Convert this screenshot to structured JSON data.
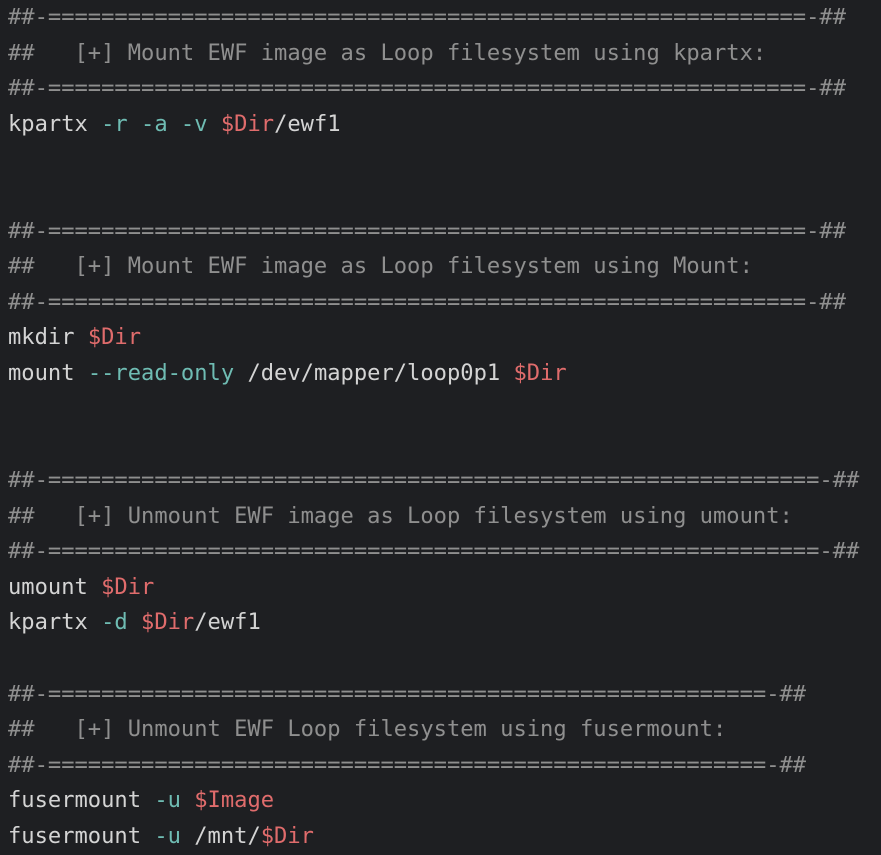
{
  "colors": {
    "background": "#1e1f22",
    "comment": "#8f8f8f",
    "text": "#d4d4d4",
    "flag": "#6fbcb3",
    "variable": "#e06c6c"
  },
  "lines": [
    [
      {
        "t": "comment",
        "v": "##-=========================================================-##"
      }
    ],
    [
      {
        "t": "comment",
        "v": "##   [+] Mount EWF image as Loop filesystem using kpartx:"
      }
    ],
    [
      {
        "t": "comment",
        "v": "##-=========================================================-##"
      }
    ],
    [
      {
        "t": "plain",
        "v": "kpartx "
      },
      {
        "t": "flag",
        "v": "-r -a -v "
      },
      {
        "t": "var",
        "v": "$Dir"
      },
      {
        "t": "plain",
        "v": "/ewf1"
      }
    ],
    [],
    [],
    [
      {
        "t": "comment",
        "v": "##-=========================================================-##"
      }
    ],
    [
      {
        "t": "comment",
        "v": "##   [+] Mount EWF image as Loop filesystem using Mount:"
      }
    ],
    [
      {
        "t": "comment",
        "v": "##-=========================================================-##"
      }
    ],
    [
      {
        "t": "plain",
        "v": "mkdir "
      },
      {
        "t": "var",
        "v": "$Dir"
      }
    ],
    [
      {
        "t": "plain",
        "v": "mount "
      },
      {
        "t": "flag",
        "v": "--read-only "
      },
      {
        "t": "plain",
        "v": "/dev/mapper/loop0p1 "
      },
      {
        "t": "var",
        "v": "$Dir"
      }
    ],
    [],
    [],
    [
      {
        "t": "comment",
        "v": "##-==========================================================-##"
      }
    ],
    [
      {
        "t": "comment",
        "v": "##   [+] Unmount EWF image as Loop filesystem using umount:"
      }
    ],
    [
      {
        "t": "comment",
        "v": "##-==========================================================-##"
      }
    ],
    [
      {
        "t": "plain",
        "v": "umount "
      },
      {
        "t": "var",
        "v": "$Dir"
      }
    ],
    [
      {
        "t": "plain",
        "v": "kpartx "
      },
      {
        "t": "flag",
        "v": "-d "
      },
      {
        "t": "var",
        "v": "$Dir"
      },
      {
        "t": "plain",
        "v": "/ewf1"
      }
    ],
    [],
    [
      {
        "t": "comment",
        "v": "##-======================================================-##"
      }
    ],
    [
      {
        "t": "comment",
        "v": "##   [+] Unmount EWF Loop filesystem using fusermount:"
      }
    ],
    [
      {
        "t": "comment",
        "v": "##-======================================================-##"
      }
    ],
    [
      {
        "t": "plain",
        "v": "fusermount "
      },
      {
        "t": "flag",
        "v": "-u "
      },
      {
        "t": "var",
        "v": "$Image"
      }
    ],
    [
      {
        "t": "plain",
        "v": "fusermount "
      },
      {
        "t": "flag",
        "v": "-u "
      },
      {
        "t": "plain",
        "v": "/mnt/"
      },
      {
        "t": "var",
        "v": "$Dir"
      }
    ]
  ]
}
